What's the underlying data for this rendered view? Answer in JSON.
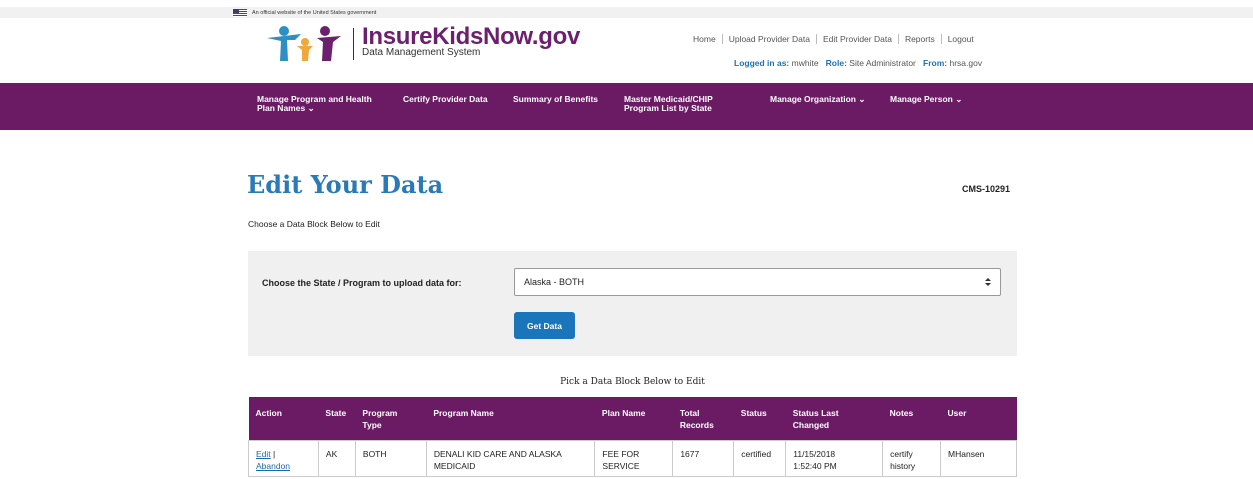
{
  "gov_banner": {
    "text": "An official website of the United States government"
  },
  "brand": {
    "title": "InsureKidsNow.gov",
    "subtitle": "Data Management System"
  },
  "util_nav": {
    "items": [
      "Home",
      "Upload Provider Data",
      "Edit Provider Data",
      "Reports",
      "Logout"
    ]
  },
  "login": {
    "logged_label": "Logged in as:",
    "logged_value": "mwhite",
    "role_label": "Role:",
    "role_value": "Site Administrator",
    "from_label": "From:",
    "from_value": "hrsa.gov"
  },
  "main_nav": {
    "manage_program_1": "Manage Program and Health",
    "manage_program_2": "Plan Names",
    "certify": "Certify Provider Data",
    "summary": "Summary of Benefits",
    "master_1": "Master Medicaid/CHIP",
    "master_2": "Program List by State",
    "manage_org": "Manage Organization",
    "manage_person": "Manage Person"
  },
  "page": {
    "title": "Edit Your Data",
    "form_code": "CMS-10291",
    "intro": "Choose a Data Block Below to Edit"
  },
  "form": {
    "label": "Choose the State / Program to upload data for:",
    "selected": "Alaska - BOTH",
    "button": "Get Data"
  },
  "table": {
    "caption": "Pick a Data Block Below to Edit",
    "headers": {
      "action": "Action",
      "state": "State",
      "program_type_1": "Program",
      "program_type_2": "Type",
      "program_name": "Program Name",
      "plan_name": "Plan Name",
      "total_1": "Total",
      "total_2": "Records",
      "status": "Status",
      "changed_1": "Status Last",
      "changed_2": "Changed",
      "notes": "Notes",
      "user": "User"
    },
    "row": {
      "edit": "Edit",
      "abandon": "Abandon",
      "state": "AK",
      "program_type": "BOTH",
      "program_name_1": "DENALI KID CARE AND ALASKA",
      "program_name_2": "MEDICAID",
      "plan_name_1": "FEE FOR",
      "plan_name_2": "SERVICE",
      "total": "1677",
      "status": "certified",
      "changed_1": "11/15/2018",
      "changed_2": "1:52:40 PM",
      "notes_1": "certify",
      "notes_2": "history",
      "user": "MHansen"
    }
  },
  "colors": {
    "nav_purple": "#6a1b64",
    "brand_purple": "#6b1f6e",
    "title_blue": "#2a7ab5",
    "button_blue": "#1b75bb"
  }
}
